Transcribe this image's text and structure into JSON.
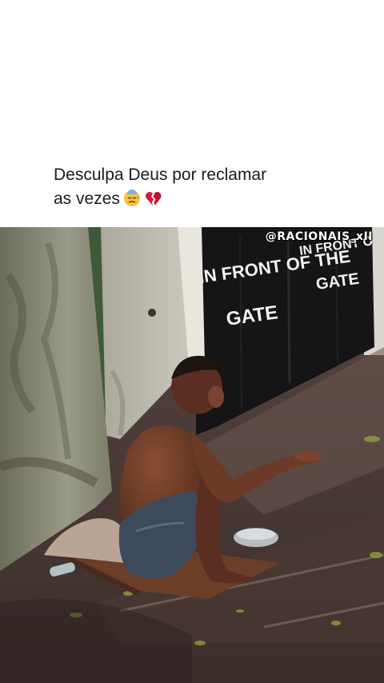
{
  "caption": {
    "line1": "Desculpa Deus por reclamar",
    "line2": "as vezes",
    "emojis": [
      "downcast-face-with-sweat",
      "broken-heart"
    ]
  },
  "photo": {
    "watermark": "@RACIONAIS_xII",
    "sign_text": {
      "left_line1": "IN FRONT OF THE",
      "left_line2": "GATE",
      "right_line1": "IN FRONT O",
      "right_line2": "GATE"
    },
    "colors": {
      "wall": "#8a8a78",
      "gate": "#151517",
      "ground": "#4a3a33",
      "skin": "#6b3a28",
      "shorts": "#3c4a5c"
    }
  }
}
